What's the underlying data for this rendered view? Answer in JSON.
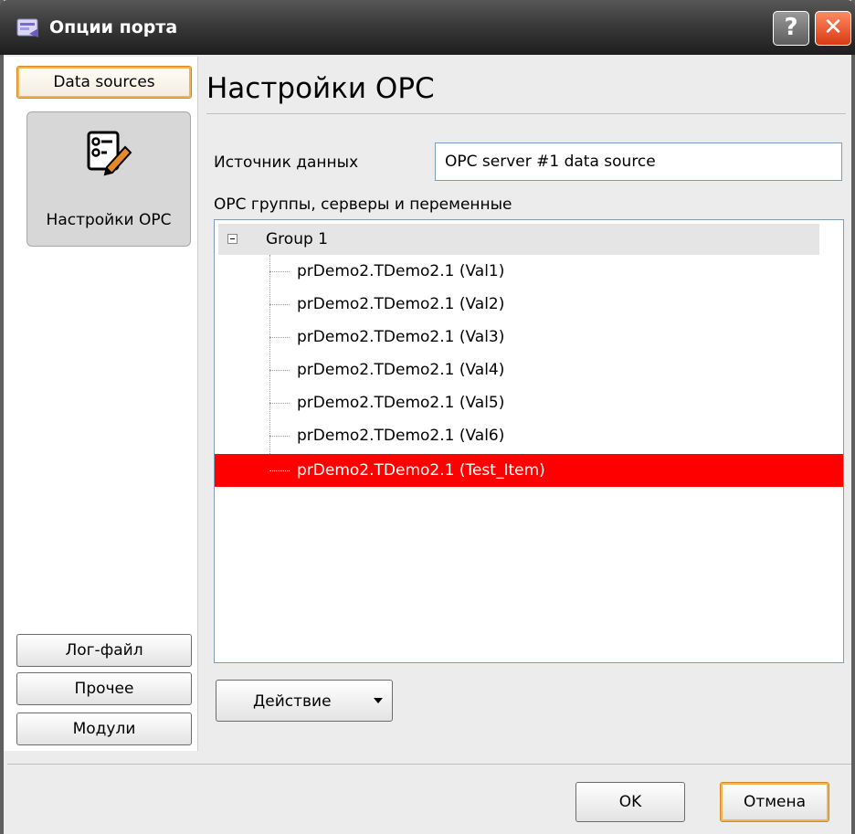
{
  "window": {
    "title": "Опции порта",
    "help_label": "?",
    "close_label": "✕"
  },
  "sidebar": {
    "data_sources_label": "Data sources",
    "opc_settings_label": "Настройки OPC",
    "log_file_label": "Лог-файл",
    "other_label": "Прочее",
    "modules_label": "Модули"
  },
  "main": {
    "heading": "Настройки OPC",
    "data_source_label": "Источник данных",
    "data_source_value": "OPC server #1 data source",
    "groups_label": "OPC группы, серверы и переменные",
    "tree": {
      "group_label": "Group 1",
      "items": [
        "prDemo2.TDemo2.1 (Val1)",
        "prDemo2.TDemo2.1 (Val2)",
        "prDemo2.TDemo2.1 (Val3)",
        "prDemo2.TDemo2.1 (Val4)",
        "prDemo2.TDemo2.1 (Val5)",
        "prDemo2.TDemo2.1 (Val6)",
        "prDemo2.TDemo2.1 (Test_Item)"
      ],
      "selected_index": 6
    },
    "action_label": "Действие"
  },
  "footer": {
    "ok_label": "OK",
    "cancel_label": "Отмена"
  },
  "colors": {
    "selection": "#ff0000",
    "focus_border": "#f7b24d"
  }
}
